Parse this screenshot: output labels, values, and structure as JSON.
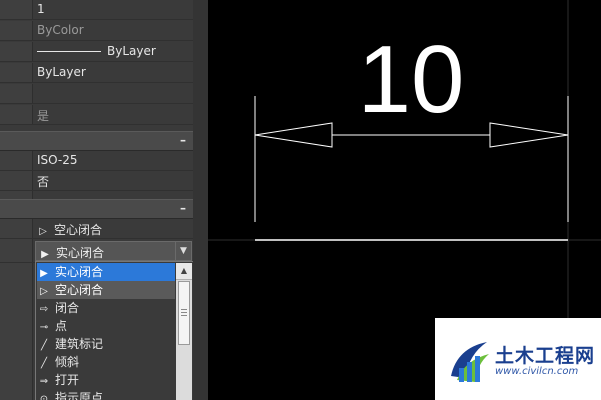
{
  "properties": {
    "rows": [
      {
        "value": "1",
        "dim": false
      },
      {
        "value": "ByColor",
        "dim": true
      },
      {
        "value": "ByLayer",
        "dim": false,
        "line_sample": true
      },
      {
        "value": "ByLayer",
        "dim": false
      },
      {
        "value": "",
        "dim": false
      },
      {
        "value": "是",
        "dim": true
      }
    ],
    "section2_rows": [
      {
        "value": "ISO-25"
      },
      {
        "value": "否"
      }
    ],
    "collapse_glyph": "–",
    "arrow_row": {
      "value": "空心闭合",
      "glyph": "▷"
    },
    "combo": {
      "value": "实心闭合",
      "glyph": "▶",
      "arrow": "▼"
    }
  },
  "dropdown": {
    "options": [
      {
        "label": "实心闭合",
        "glyph": "▶",
        "state": "selected"
      },
      {
        "label": "空心闭合",
        "glyph": "▷",
        "state": "hover"
      },
      {
        "label": "闭合",
        "glyph": "⇨",
        "state": ""
      },
      {
        "label": "点",
        "glyph": "⊸",
        "state": ""
      },
      {
        "label": "建筑标记",
        "glyph": "╱",
        "state": ""
      },
      {
        "label": "倾斜",
        "glyph": "╱",
        "state": ""
      },
      {
        "label": "打开",
        "glyph": "⇒",
        "state": ""
      },
      {
        "label": "指示原点",
        "glyph": "⊙",
        "state": ""
      }
    ],
    "scroll_up": "▲"
  },
  "drawing": {
    "dimension_text": "10",
    "colors": {
      "background": "#000000",
      "lines": "#ffffff",
      "grid": "#3a3a3a"
    }
  },
  "watermark": {
    "name": "土木工程网",
    "url": "www.civilcn.com",
    "colors": {
      "navy": "#1a3f8f",
      "green": "#6cbf3c",
      "blue": "#2c79d9"
    }
  }
}
